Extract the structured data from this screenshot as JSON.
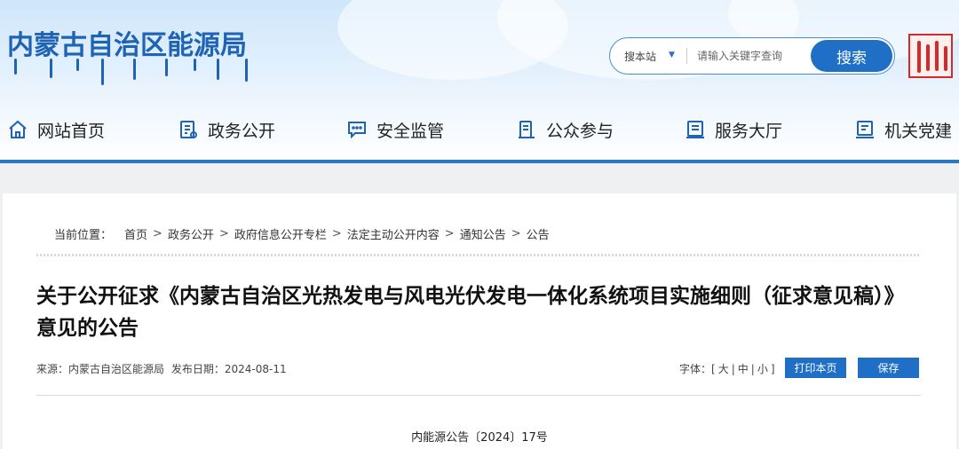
{
  "header": {
    "site_title": "内蒙古自治区能源局",
    "search": {
      "scope": "搜本站",
      "placeholder": "请输入关键字查询",
      "button": "搜索"
    }
  },
  "nav": [
    {
      "label": "网站首页",
      "icon": "home-icon"
    },
    {
      "label": "政务公开",
      "icon": "document-list-icon"
    },
    {
      "label": "安全监管",
      "icon": "chat-message-icon"
    },
    {
      "label": "公众参与",
      "icon": "participation-doc-icon"
    },
    {
      "label": "服务大厅",
      "icon": "service-hall-icon"
    },
    {
      "label": "机关党建",
      "icon": "party-building-icon"
    }
  ],
  "breadcrumb": {
    "label": "当前位置：",
    "items": [
      "首页",
      "政务公开",
      "政府信息公开专栏",
      "法定主动公开内容",
      "通知公告",
      "公告"
    ],
    "separator": ">"
  },
  "article": {
    "title": "关于公开征求《内蒙古自治区光热发电与风电光伏发电一体化系统项目实施细则（征求意见稿）》意见的公告",
    "source_label": "来源：",
    "source": "内蒙古自治区能源局",
    "date_label": "发布日期：",
    "date": "2024-08-11",
    "font_size_label": "字体：",
    "font_sizes": [
      "大",
      "中",
      "小"
    ],
    "print_button": "打印本页",
    "save_button": "保存",
    "doc_number": "内能源公告〔2024〕17号"
  },
  "colors": {
    "brand_blue": "#1f63b5",
    "button_blue": "#1f6fc6",
    "seal_red": "#d42a2a"
  }
}
